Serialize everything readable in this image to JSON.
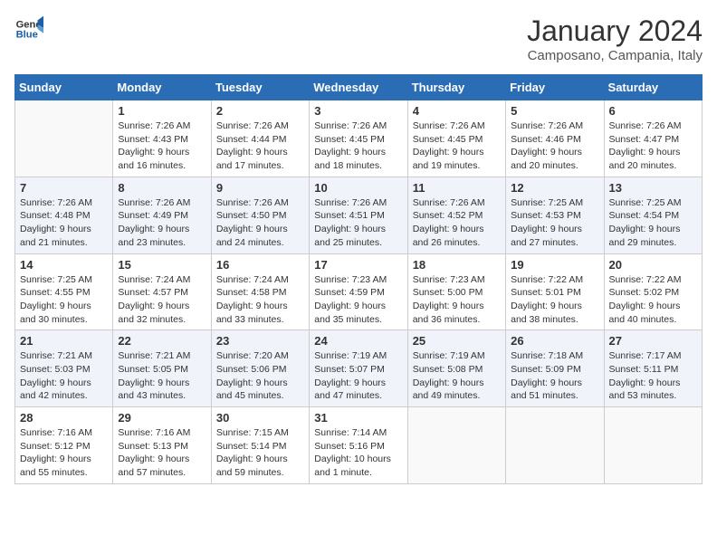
{
  "header": {
    "logo_line1": "General",
    "logo_line2": "Blue",
    "month": "January 2024",
    "location": "Camposano, Campania, Italy"
  },
  "weekdays": [
    "Sunday",
    "Monday",
    "Tuesday",
    "Wednesday",
    "Thursday",
    "Friday",
    "Saturday"
  ],
  "weeks": [
    [
      {
        "day": "",
        "info": ""
      },
      {
        "day": "1",
        "info": "Sunrise: 7:26 AM\nSunset: 4:43 PM\nDaylight: 9 hours\nand 16 minutes."
      },
      {
        "day": "2",
        "info": "Sunrise: 7:26 AM\nSunset: 4:44 PM\nDaylight: 9 hours\nand 17 minutes."
      },
      {
        "day": "3",
        "info": "Sunrise: 7:26 AM\nSunset: 4:45 PM\nDaylight: 9 hours\nand 18 minutes."
      },
      {
        "day": "4",
        "info": "Sunrise: 7:26 AM\nSunset: 4:45 PM\nDaylight: 9 hours\nand 19 minutes."
      },
      {
        "day": "5",
        "info": "Sunrise: 7:26 AM\nSunset: 4:46 PM\nDaylight: 9 hours\nand 20 minutes."
      },
      {
        "day": "6",
        "info": "Sunrise: 7:26 AM\nSunset: 4:47 PM\nDaylight: 9 hours\nand 20 minutes."
      }
    ],
    [
      {
        "day": "7",
        "info": "Sunrise: 7:26 AM\nSunset: 4:48 PM\nDaylight: 9 hours\nand 21 minutes."
      },
      {
        "day": "8",
        "info": "Sunrise: 7:26 AM\nSunset: 4:49 PM\nDaylight: 9 hours\nand 23 minutes."
      },
      {
        "day": "9",
        "info": "Sunrise: 7:26 AM\nSunset: 4:50 PM\nDaylight: 9 hours\nand 24 minutes."
      },
      {
        "day": "10",
        "info": "Sunrise: 7:26 AM\nSunset: 4:51 PM\nDaylight: 9 hours\nand 25 minutes."
      },
      {
        "day": "11",
        "info": "Sunrise: 7:26 AM\nSunset: 4:52 PM\nDaylight: 9 hours\nand 26 minutes."
      },
      {
        "day": "12",
        "info": "Sunrise: 7:25 AM\nSunset: 4:53 PM\nDaylight: 9 hours\nand 27 minutes."
      },
      {
        "day": "13",
        "info": "Sunrise: 7:25 AM\nSunset: 4:54 PM\nDaylight: 9 hours\nand 29 minutes."
      }
    ],
    [
      {
        "day": "14",
        "info": "Sunrise: 7:25 AM\nSunset: 4:55 PM\nDaylight: 9 hours\nand 30 minutes."
      },
      {
        "day": "15",
        "info": "Sunrise: 7:24 AM\nSunset: 4:57 PM\nDaylight: 9 hours\nand 32 minutes."
      },
      {
        "day": "16",
        "info": "Sunrise: 7:24 AM\nSunset: 4:58 PM\nDaylight: 9 hours\nand 33 minutes."
      },
      {
        "day": "17",
        "info": "Sunrise: 7:23 AM\nSunset: 4:59 PM\nDaylight: 9 hours\nand 35 minutes."
      },
      {
        "day": "18",
        "info": "Sunrise: 7:23 AM\nSunset: 5:00 PM\nDaylight: 9 hours\nand 36 minutes."
      },
      {
        "day": "19",
        "info": "Sunrise: 7:22 AM\nSunset: 5:01 PM\nDaylight: 9 hours\nand 38 minutes."
      },
      {
        "day": "20",
        "info": "Sunrise: 7:22 AM\nSunset: 5:02 PM\nDaylight: 9 hours\nand 40 minutes."
      }
    ],
    [
      {
        "day": "21",
        "info": "Sunrise: 7:21 AM\nSunset: 5:03 PM\nDaylight: 9 hours\nand 42 minutes."
      },
      {
        "day": "22",
        "info": "Sunrise: 7:21 AM\nSunset: 5:05 PM\nDaylight: 9 hours\nand 43 minutes."
      },
      {
        "day": "23",
        "info": "Sunrise: 7:20 AM\nSunset: 5:06 PM\nDaylight: 9 hours\nand 45 minutes."
      },
      {
        "day": "24",
        "info": "Sunrise: 7:19 AM\nSunset: 5:07 PM\nDaylight: 9 hours\nand 47 minutes."
      },
      {
        "day": "25",
        "info": "Sunrise: 7:19 AM\nSunset: 5:08 PM\nDaylight: 9 hours\nand 49 minutes."
      },
      {
        "day": "26",
        "info": "Sunrise: 7:18 AM\nSunset: 5:09 PM\nDaylight: 9 hours\nand 51 minutes."
      },
      {
        "day": "27",
        "info": "Sunrise: 7:17 AM\nSunset: 5:11 PM\nDaylight: 9 hours\nand 53 minutes."
      }
    ],
    [
      {
        "day": "28",
        "info": "Sunrise: 7:16 AM\nSunset: 5:12 PM\nDaylight: 9 hours\nand 55 minutes."
      },
      {
        "day": "29",
        "info": "Sunrise: 7:16 AM\nSunset: 5:13 PM\nDaylight: 9 hours\nand 57 minutes."
      },
      {
        "day": "30",
        "info": "Sunrise: 7:15 AM\nSunset: 5:14 PM\nDaylight: 9 hours\nand 59 minutes."
      },
      {
        "day": "31",
        "info": "Sunrise: 7:14 AM\nSunset: 5:16 PM\nDaylight: 10 hours\nand 1 minute."
      },
      {
        "day": "",
        "info": ""
      },
      {
        "day": "",
        "info": ""
      },
      {
        "day": "",
        "info": ""
      }
    ]
  ]
}
